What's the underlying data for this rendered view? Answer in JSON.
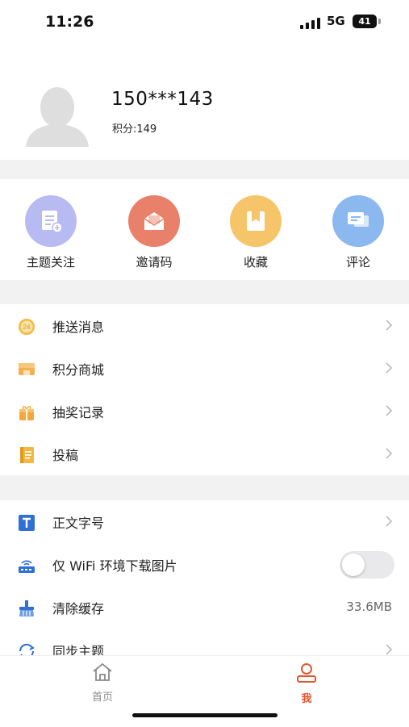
{
  "status_bar": {
    "time": "11:26",
    "network": "5G",
    "battery": "41"
  },
  "profile": {
    "username": "150***143",
    "points": "积分:149"
  },
  "quick_actions": [
    {
      "label": "主题关注",
      "icon": "document-plus-icon",
      "color": "#b7bbf2"
    },
    {
      "label": "邀请码",
      "icon": "envelope-icon",
      "color": "#e9806a"
    },
    {
      "label": "收藏",
      "icon": "bookmark-icon",
      "color": "#f6c469"
    },
    {
      "label": "评论",
      "icon": "chat-bubbles-icon",
      "color": "#8ab8ef"
    }
  ],
  "menu_group_1": [
    {
      "label": "推送消息",
      "icon": "clock-24-icon"
    },
    {
      "label": "积分商城",
      "icon": "shop-icon"
    },
    {
      "label": "抽奖记录",
      "icon": "gift-icon"
    },
    {
      "label": "投稿",
      "icon": "notepad-icon"
    }
  ],
  "menu_group_2": [
    {
      "label": "正文字号",
      "icon": "font-size-icon"
    },
    {
      "label": "仅 WiFi 环境下载图片",
      "icon": "router-icon",
      "toggle": false
    },
    {
      "label": "清除缓存",
      "icon": "broom-icon",
      "value": "33.6MB"
    },
    {
      "label": "同步主题",
      "icon": "sync-icon"
    }
  ],
  "tab_bar": [
    {
      "label": "首页",
      "icon": "home-icon",
      "active": false
    },
    {
      "label": "我",
      "icon": "user-icon",
      "active": true
    }
  ],
  "colors": {
    "accent": "#e8542a",
    "inactive_tab": "#8a8a8a",
    "section_gap": "#f2f2f2"
  }
}
